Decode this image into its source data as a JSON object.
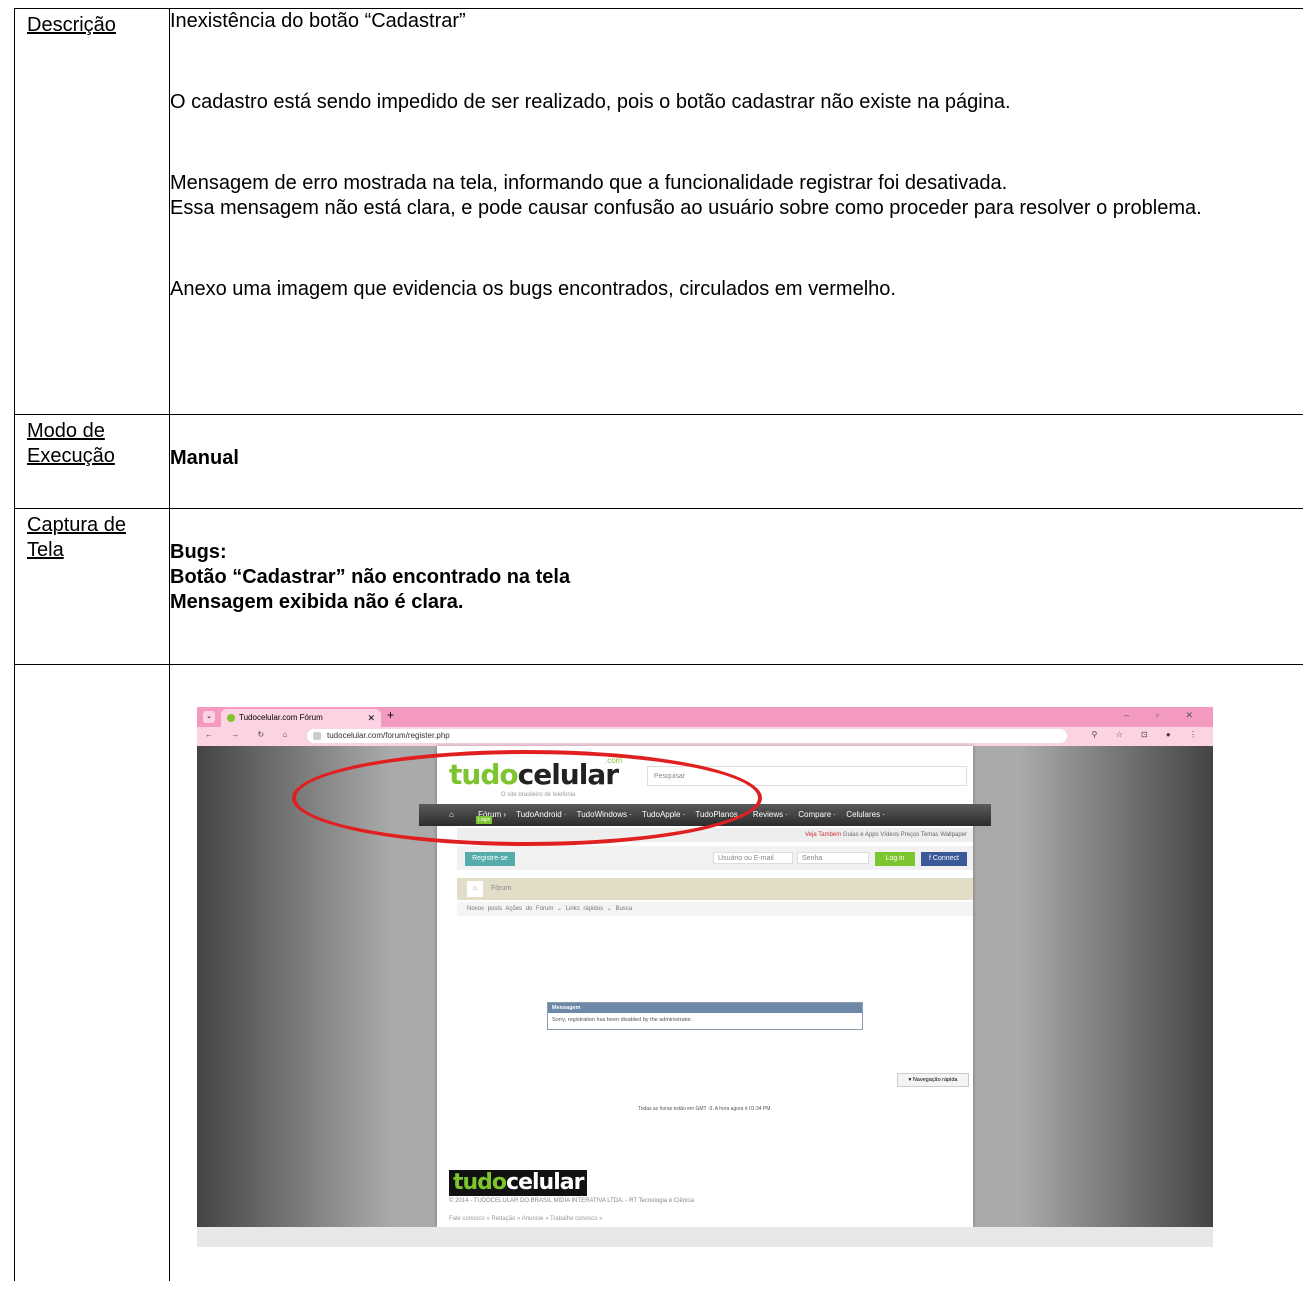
{
  "rows": {
    "descricao": {
      "label": "Descrição",
      "p1": "Inexistência do botão “Cadastrar”",
      "p2": "O cadastro está sendo impedido de ser realizado, pois o botão cadastrar não existe na página.",
      "p3a": "Mensagem de erro mostrada na tela, informando que a funcionalidade registrar foi desativada.",
      "p3b": "Essa mensagem não está clara, e pode causar confusão ao usuário sobre como proceder para resolver o problema.",
      "p4": "Anexo uma imagem que evidencia os bugs encontrados, circulados em vermelho."
    },
    "modo": {
      "label_line1": "Modo de",
      "label_line2": "Execução",
      "value": "Manual"
    },
    "captura": {
      "label_line1": "Captura de",
      "label_line2": "Tela",
      "line1": "Bugs:",
      "line2": "Botão “Cadastrar” não encontrado na tela",
      "line3": "Mensagem exibida não é clara."
    }
  },
  "screenshot": {
    "tab_title": "Tudocelular.com Fórum",
    "url": "tudocelular.com/forum/register.php",
    "logo_part1": "tudo",
    "logo_part2": "celular",
    "logo_com": ".com",
    "logo_tagline": "O site brasileiro de telefonia",
    "search_placeholder": "Pesquisar",
    "login_badge": "Login",
    "nav_items": [
      "Fórum ›",
      "TudoAndroid ·",
      "TudoWindows ·",
      "TudoApple ·",
      "TudoPlanos ·",
      "Reviews ·",
      "Compare ·",
      "Celulares ·"
    ],
    "subnav_highlight": "Veja Também",
    "subnav_items": "Guias e Apps   Vídeos   Preços   Temas   Wallpaper",
    "register_button": "Registre-se",
    "user_placeholder": "Usuário ou E-mail",
    "password_placeholder": "Senha",
    "login_button": "Log in",
    "facebook_button": "f  Connect",
    "breadcrumb": "Fórum",
    "subtabs": "Novos posts    Ações do Fórum ⌄    Links rápidos ⌄    Busca",
    "message_title": "Mensagem",
    "message_body": "Sorry, registration has been disabled by the administrator.",
    "quick_nav": "▾ Navegação rápida",
    "time_text": "Todas as horas estão em GMT -3. A hora agora é 01:34 PM.",
    "footer_copy": "© 2014 - TUDOCELULAR DO BRASIL MIDIA INTERATIVA LTDA. - RT Tecnologia e Ciência",
    "footer_links": "Fale conosco » Redação » Anuncie » Trabalhe conosco »",
    "annotation_color": "#e02020"
  }
}
